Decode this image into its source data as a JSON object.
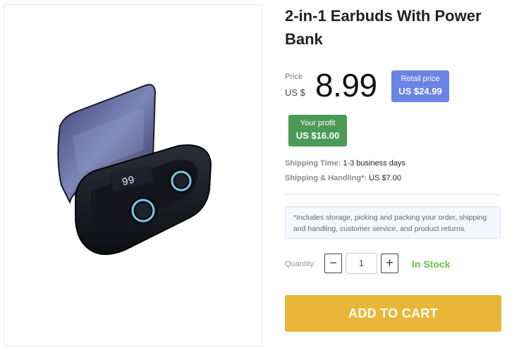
{
  "product": {
    "title": "2-in-1 Earbuds With Power Bank",
    "image_alt": "black wireless earbuds in charging case with digital display"
  },
  "price": {
    "label": "Price",
    "currency": "US $",
    "amount": "8.99"
  },
  "retail": {
    "label": "Retail price",
    "value": "US $24.99",
    "color": "#6b84e4"
  },
  "profit": {
    "label": "Your profit",
    "value": "US $16.00",
    "color": "#4c9a57"
  },
  "shipping": {
    "time_label": "Shipping Time:",
    "time_value": "1-3 business days",
    "handling_label": "Shipping & Handling*:",
    "handling_value": "US $7.00"
  },
  "note": "*Includes storage, picking and packing your order, shipping and handling, customer service, and product returns.",
  "quantity": {
    "label": "Quantity:",
    "minus": "−",
    "plus": "+",
    "value": "1"
  },
  "stock": {
    "text": "In Stock",
    "color": "#6cbf4a"
  },
  "cart": {
    "label": "ADD TO CART",
    "color": "#e8b737"
  },
  "display_digits": "99"
}
